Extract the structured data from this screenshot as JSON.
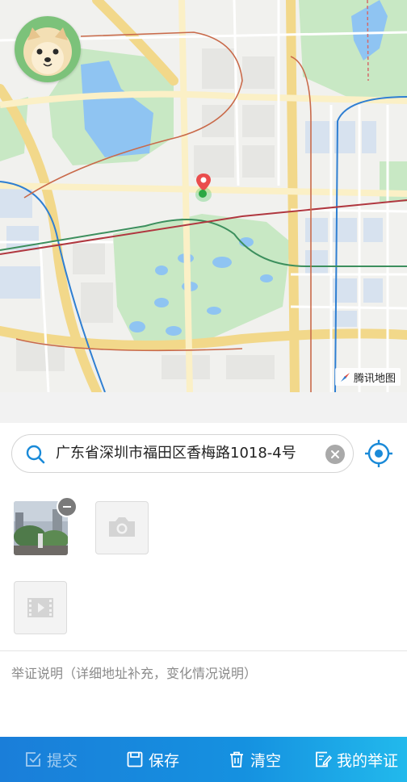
{
  "map": {
    "provider_label": "腾讯地图",
    "avatar_icon": "dog-avatar-icon",
    "marker_icon": "location-pin-icon",
    "colors": {
      "park": "#c8e8c4",
      "water": "#8fc4f2",
      "road": "#f7e6a6",
      "metro_blue": "#2f7fd2",
      "metro_green": "#3c8f5d",
      "metro_red": "#b0373f"
    }
  },
  "search": {
    "address": "广东省深圳市福田区香梅路1018-4号",
    "clear_icon": "clear-icon",
    "locate_icon": "locate-icon"
  },
  "media": {
    "photo_remove_icon": "remove-icon",
    "add_photo_icon": "camera-icon",
    "add_video_icon": "video-icon"
  },
  "description": {
    "placeholder": "举证说明（详细地址补充，变化情况说明）"
  },
  "toolbar": {
    "submit": "提交",
    "save": "保存",
    "clear": "清空",
    "my_evidence": "我的举证"
  }
}
